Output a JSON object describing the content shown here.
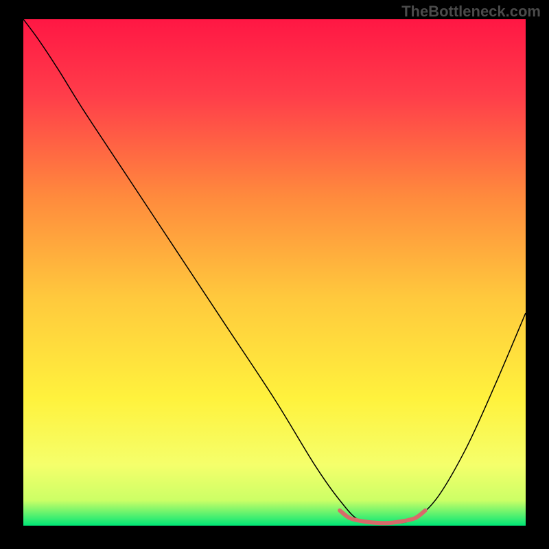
{
  "watermark": "TheBottleneck.com",
  "chart_data": {
    "type": "line",
    "title": "",
    "xlabel": "",
    "ylabel": "",
    "xlim": [
      0,
      100
    ],
    "ylim": [
      0,
      100
    ],
    "background_gradient": {
      "type": "vertical",
      "stops": [
        {
          "pos": 0.0,
          "color": "#ff1744"
        },
        {
          "pos": 0.15,
          "color": "#ff3d4a"
        },
        {
          "pos": 0.35,
          "color": "#ff8a3d"
        },
        {
          "pos": 0.55,
          "color": "#ffc93d"
        },
        {
          "pos": 0.75,
          "color": "#fff23d"
        },
        {
          "pos": 0.88,
          "color": "#f5ff6b"
        },
        {
          "pos": 0.95,
          "color": "#ccff66"
        },
        {
          "pos": 1.0,
          "color": "#00e676"
        }
      ]
    },
    "series": [
      {
        "name": "bottleneck-curve",
        "color": "#000000",
        "width": 1.5,
        "points": [
          {
            "x": 0,
            "y": 100
          },
          {
            "x": 3,
            "y": 96
          },
          {
            "x": 7,
            "y": 90
          },
          {
            "x": 12,
            "y": 82
          },
          {
            "x": 20,
            "y": 70
          },
          {
            "x": 30,
            "y": 55
          },
          {
            "x": 40,
            "y": 40
          },
          {
            "x": 50,
            "y": 25
          },
          {
            "x": 58,
            "y": 12
          },
          {
            "x": 63,
            "y": 5
          },
          {
            "x": 67,
            "y": 1
          },
          {
            "x": 72,
            "y": 0.5
          },
          {
            "x": 77,
            "y": 1
          },
          {
            "x": 82,
            "y": 5
          },
          {
            "x": 88,
            "y": 15
          },
          {
            "x": 94,
            "y": 28
          },
          {
            "x": 100,
            "y": 42
          }
        ]
      },
      {
        "name": "optimal-range-marker",
        "color": "#d86a6a",
        "width": 6,
        "points": [
          {
            "x": 63,
            "y": 3
          },
          {
            "x": 65,
            "y": 1.5
          },
          {
            "x": 68,
            "y": 0.8
          },
          {
            "x": 72,
            "y": 0.5
          },
          {
            "x": 75,
            "y": 0.8
          },
          {
            "x": 78,
            "y": 1.5
          },
          {
            "x": 80,
            "y": 3
          }
        ]
      }
    ]
  }
}
